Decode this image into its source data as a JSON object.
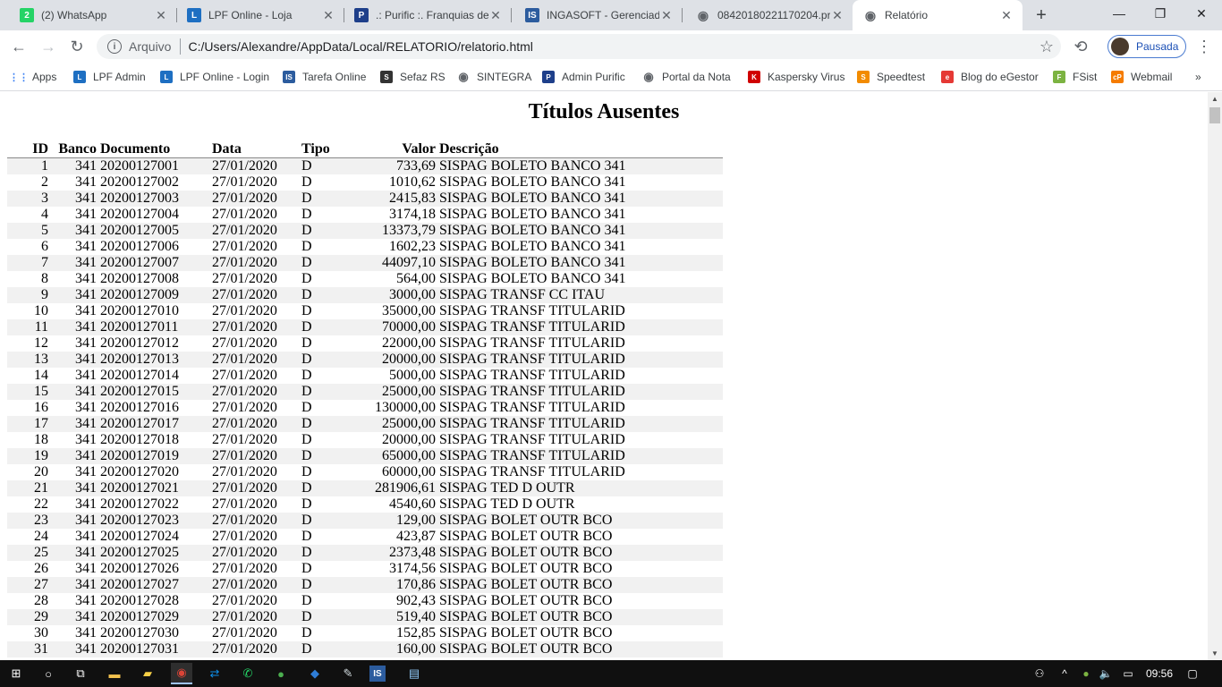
{
  "browser": {
    "tabs": [
      {
        "title": "(2) WhatsApp",
        "icon": "whatsapp-icon",
        "color": "#25d366",
        "glyph": "2",
        "active": false
      },
      {
        "title": "LPF Online - Loja",
        "icon": "lpf-icon",
        "color": "#1e6fc2",
        "glyph": "L",
        "active": false
      },
      {
        "title": ".: Purific :. Franquias de",
        "icon": "purific-icon",
        "color": "#1e3f8a",
        "glyph": "P",
        "active": false
      },
      {
        "title": "INGASOFT - Gerenciado",
        "icon": "ingasoft-icon",
        "color": "#2c5c9e",
        "glyph": "IS",
        "active": false
      },
      {
        "title": "08420180221170204.pr",
        "icon": "globe-icon",
        "color": "#5f6368",
        "glyph": "◉",
        "active": false
      },
      {
        "title": "Relatório",
        "icon": "globe-icon",
        "color": "#5f6368",
        "glyph": "◉",
        "active": true
      }
    ],
    "new_tab": "+",
    "window_controls": {
      "minimize": "—",
      "restore": "❐",
      "close": "✕"
    },
    "toolbar": {
      "back": "←",
      "forward": "→",
      "reload": "↻",
      "scheme_label": "Arquivo",
      "url": "C:/Users/Alexandre/AppData/Local/RELATORIO/relatorio.html",
      "star": "☆",
      "sync_icon": "⟲",
      "profile_label": "Pausada",
      "menu": "⋮"
    },
    "bookmarks": [
      {
        "label": "Apps",
        "icon": "apps-grid-icon",
        "color": "#4285f4",
        "glyph": "⋮⋮"
      },
      {
        "label": "LPF Admin",
        "icon": "lpf-icon",
        "color": "#1e6fc2",
        "glyph": "L"
      },
      {
        "label": "LPF Online - Login",
        "icon": "lpf-icon",
        "color": "#1e6fc2",
        "glyph": "L"
      },
      {
        "label": "Tarefa Online",
        "icon": "ingasoft-icon",
        "color": "#2c5c9e",
        "glyph": "IS"
      },
      {
        "label": "Sefaz RS",
        "icon": "sefaz-icon",
        "color": "#333333",
        "glyph": "S"
      },
      {
        "label": "SINTEGRA",
        "icon": "globe-icon",
        "color": "#5f6368",
        "glyph": "◉"
      },
      {
        "label": "Admin Purific",
        "icon": "purific-icon",
        "color": "#1e3f8a",
        "glyph": "P"
      },
      {
        "label": "Portal da Nota",
        "icon": "globe-icon",
        "color": "#5f6368",
        "glyph": "◉"
      },
      {
        "label": "Kaspersky Virus",
        "icon": "kaspersky-icon",
        "color": "#d00000",
        "glyph": "K"
      },
      {
        "label": "Speedtest",
        "icon": "speedtest-icon",
        "color": "#f28b00",
        "glyph": "S"
      },
      {
        "label": "Blog do eGestor",
        "icon": "egestor-icon",
        "color": "#e53935",
        "glyph": "e"
      },
      {
        "label": "FSist",
        "icon": "fsist-icon",
        "color": "#7cb342",
        "glyph": "F"
      },
      {
        "label": "Webmail",
        "icon": "webmail-icon",
        "color": "#f57c00",
        "glyph": "cP"
      }
    ],
    "bookmarks_more": "»"
  },
  "report": {
    "title": "Títulos Ausentes",
    "columns": {
      "id": "ID",
      "bank": "Banco",
      "document": "Documento",
      "date": "Data",
      "type": "Tipo",
      "value": "Valor",
      "description": "Descrição"
    },
    "rows": [
      {
        "id": "1",
        "bank": "341",
        "document": "20200127001",
        "date": "27/01/2020",
        "type": "D",
        "value": "733,69",
        "description": "SISPAG BOLETO BANCO 341"
      },
      {
        "id": "2",
        "bank": "341",
        "document": "20200127002",
        "date": "27/01/2020",
        "type": "D",
        "value": "1010,62",
        "description": "SISPAG BOLETO BANCO 341"
      },
      {
        "id": "3",
        "bank": "341",
        "document": "20200127003",
        "date": "27/01/2020",
        "type": "D",
        "value": "2415,83",
        "description": "SISPAG BOLETO BANCO 341"
      },
      {
        "id": "4",
        "bank": "341",
        "document": "20200127004",
        "date": "27/01/2020",
        "type": "D",
        "value": "3174,18",
        "description": "SISPAG BOLETO BANCO 341"
      },
      {
        "id": "5",
        "bank": "341",
        "document": "20200127005",
        "date": "27/01/2020",
        "type": "D",
        "value": "13373,79",
        "description": "SISPAG BOLETO BANCO 341"
      },
      {
        "id": "6",
        "bank": "341",
        "document": "20200127006",
        "date": "27/01/2020",
        "type": "D",
        "value": "1602,23",
        "description": "SISPAG BOLETO BANCO 341"
      },
      {
        "id": "7",
        "bank": "341",
        "document": "20200127007",
        "date": "27/01/2020",
        "type": "D",
        "value": "44097,10",
        "description": "SISPAG BOLETO BANCO 341"
      },
      {
        "id": "8",
        "bank": "341",
        "document": "20200127008",
        "date": "27/01/2020",
        "type": "D",
        "value": "564,00",
        "description": "SISPAG BOLETO BANCO 341"
      },
      {
        "id": "9",
        "bank": "341",
        "document": "20200127009",
        "date": "27/01/2020",
        "type": "D",
        "value": "3000,00",
        "description": "SISPAG TRANSF CC ITAU"
      },
      {
        "id": "10",
        "bank": "341",
        "document": "20200127010",
        "date": "27/01/2020",
        "type": "D",
        "value": "35000,00",
        "description": "SISPAG TRANSF TITULARID"
      },
      {
        "id": "11",
        "bank": "341",
        "document": "20200127011",
        "date": "27/01/2020",
        "type": "D",
        "value": "70000,00",
        "description": "SISPAG TRANSF TITULARID"
      },
      {
        "id": "12",
        "bank": "341",
        "document": "20200127012",
        "date": "27/01/2020",
        "type": "D",
        "value": "22000,00",
        "description": "SISPAG TRANSF TITULARID"
      },
      {
        "id": "13",
        "bank": "341",
        "document": "20200127013",
        "date": "27/01/2020",
        "type": "D",
        "value": "20000,00",
        "description": "SISPAG TRANSF TITULARID"
      },
      {
        "id": "14",
        "bank": "341",
        "document": "20200127014",
        "date": "27/01/2020",
        "type": "D",
        "value": "5000,00",
        "description": "SISPAG TRANSF TITULARID"
      },
      {
        "id": "15",
        "bank": "341",
        "document": "20200127015",
        "date": "27/01/2020",
        "type": "D",
        "value": "25000,00",
        "description": "SISPAG TRANSF TITULARID"
      },
      {
        "id": "16",
        "bank": "341",
        "document": "20200127016",
        "date": "27/01/2020",
        "type": "D",
        "value": "130000,00",
        "description": "SISPAG TRANSF TITULARID"
      },
      {
        "id": "17",
        "bank": "341",
        "document": "20200127017",
        "date": "27/01/2020",
        "type": "D",
        "value": "25000,00",
        "description": "SISPAG TRANSF TITULARID"
      },
      {
        "id": "18",
        "bank": "341",
        "document": "20200127018",
        "date": "27/01/2020",
        "type": "D",
        "value": "20000,00",
        "description": "SISPAG TRANSF TITULARID"
      },
      {
        "id": "19",
        "bank": "341",
        "document": "20200127019",
        "date": "27/01/2020",
        "type": "D",
        "value": "65000,00",
        "description": "SISPAG TRANSF TITULARID"
      },
      {
        "id": "20",
        "bank": "341",
        "document": "20200127020",
        "date": "27/01/2020",
        "type": "D",
        "value": "60000,00",
        "description": "SISPAG TRANSF TITULARID"
      },
      {
        "id": "21",
        "bank": "341",
        "document": "20200127021",
        "date": "27/01/2020",
        "type": "D",
        "value": "281906,61",
        "description": "SISPAG TED D OUTR"
      },
      {
        "id": "22",
        "bank": "341",
        "document": "20200127022",
        "date": "27/01/2020",
        "type": "D",
        "value": "4540,60",
        "description": "SISPAG TED D OUTR"
      },
      {
        "id": "23",
        "bank": "341",
        "document": "20200127023",
        "date": "27/01/2020",
        "type": "D",
        "value": "129,00",
        "description": "SISPAG BOLET OUTR BCO"
      },
      {
        "id": "24",
        "bank": "341",
        "document": "20200127024",
        "date": "27/01/2020",
        "type": "D",
        "value": "423,87",
        "description": "SISPAG BOLET OUTR BCO"
      },
      {
        "id": "25",
        "bank": "341",
        "document": "20200127025",
        "date": "27/01/2020",
        "type": "D",
        "value": "2373,48",
        "description": "SISPAG BOLET OUTR BCO"
      },
      {
        "id": "26",
        "bank": "341",
        "document": "20200127026",
        "date": "27/01/2020",
        "type": "D",
        "value": "3174,56",
        "description": "SISPAG BOLET OUTR BCO"
      },
      {
        "id": "27",
        "bank": "341",
        "document": "20200127027",
        "date": "27/01/2020",
        "type": "D",
        "value": "170,86",
        "description": "SISPAG BOLET OUTR BCO"
      },
      {
        "id": "28",
        "bank": "341",
        "document": "20200127028",
        "date": "27/01/2020",
        "type": "D",
        "value": "902,43",
        "description": "SISPAG BOLET OUTR BCO"
      },
      {
        "id": "29",
        "bank": "341",
        "document": "20200127029",
        "date": "27/01/2020",
        "type": "D",
        "value": "519,40",
        "description": "SISPAG BOLET OUTR BCO"
      },
      {
        "id": "30",
        "bank": "341",
        "document": "20200127030",
        "date": "27/01/2020",
        "type": "D",
        "value": "152,85",
        "description": "SISPAG BOLET OUTR BCO"
      },
      {
        "id": "31",
        "bank": "341",
        "document": "20200127031",
        "date": "27/01/2020",
        "type": "D",
        "value": "160,00",
        "description": "SISPAG BOLET OUTR BCO"
      }
    ]
  },
  "taskbar": {
    "apps": [
      {
        "name": "windows-start-icon",
        "glyph": "⊞",
        "color": "#ffffff"
      },
      {
        "name": "search-icon",
        "glyph": "○",
        "color": "#ffffff"
      },
      {
        "name": "task-view-icon",
        "glyph": "⧉",
        "color": "#ffffff"
      },
      {
        "name": "file-explorer-icon",
        "glyph": "▬",
        "color": "#f2c14e"
      },
      {
        "name": "sticky-notes-icon",
        "glyph": "▰",
        "color": "#f7d046"
      },
      {
        "name": "chrome-icon",
        "glyph": "◉",
        "color": "#db4437"
      },
      {
        "name": "teamviewer-icon",
        "glyph": "⇄",
        "color": "#0e8ee9"
      },
      {
        "name": "whatsapp-icon",
        "glyph": "✆",
        "color": "#25d366"
      },
      {
        "name": "green-app-icon",
        "glyph": "●",
        "color": "#4caf50"
      },
      {
        "name": "blue-app-icon",
        "glyph": "◆",
        "color": "#2e7dd7"
      },
      {
        "name": "tool-icon",
        "glyph": "✎",
        "color": "#cfd8dc"
      },
      {
        "name": "ingasoft-icon",
        "glyph": "IS",
        "color": "#2c5c9e"
      },
      {
        "name": "notepad-icon",
        "glyph": "▤",
        "color": "#90caf9"
      }
    ],
    "tray": {
      "people": "⚇",
      "chevron": "^",
      "status": "●",
      "volume": "🔈",
      "network": "▭",
      "time": "09:56",
      "notifications": "▢"
    }
  }
}
